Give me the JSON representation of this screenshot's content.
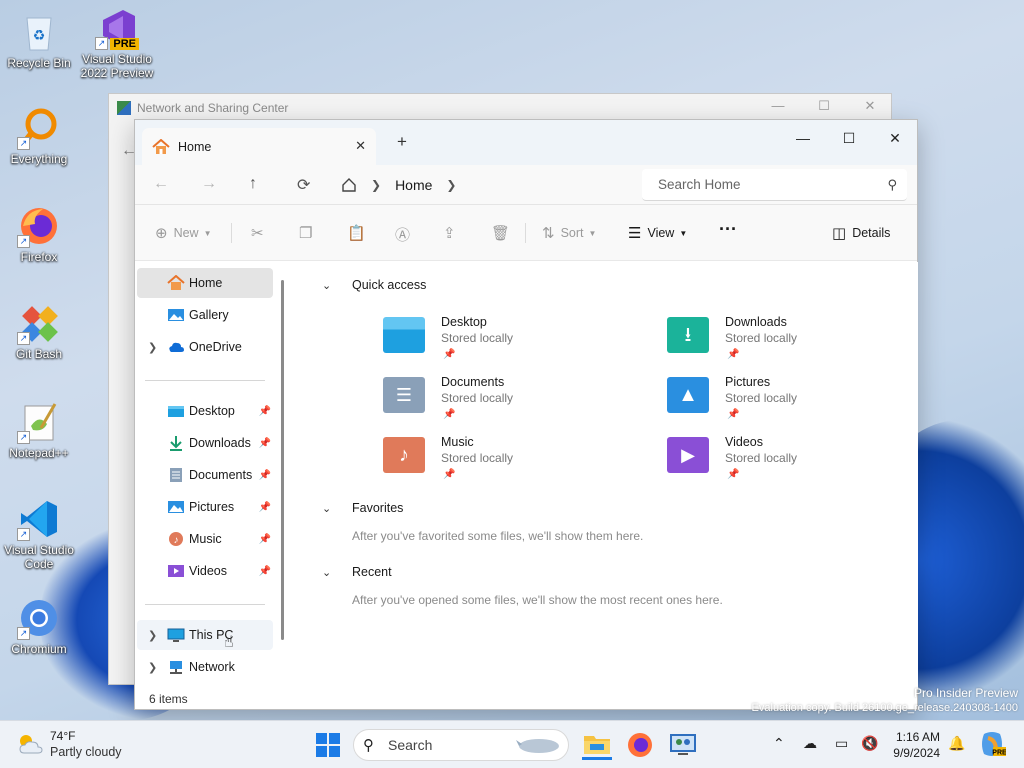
{
  "desktop": {
    "icons": [
      {
        "label": "Recycle Bin",
        "icon": "recycle-bin-icon"
      },
      {
        "label": "Visual Studio 2022 Preview",
        "icon": "visual-studio-preview-icon",
        "badge": "PRE"
      },
      {
        "label": "Everything",
        "icon": "everything-search-icon"
      },
      {
        "label": "Firefox",
        "icon": "firefox-icon"
      },
      {
        "label": "Git Bash",
        "icon": "git-bash-icon"
      },
      {
        "label": "Notepad++",
        "icon": "notepad-plus-plus-icon"
      },
      {
        "label": "Visual Studio Code",
        "icon": "vscode-icon"
      },
      {
        "label": "Chromium",
        "icon": "chromium-icon"
      }
    ],
    "watermark_line1": "Pro Insider Preview",
    "watermark_line2": "Evaluation copy. Build 26100.ge_release.240308-1400"
  },
  "background_window": {
    "title": "Network and Sharing Center"
  },
  "explorer": {
    "tab_label": "Home",
    "breadcrumb": "Home",
    "search_placeholder": "Search Home",
    "commands": {
      "new": "New",
      "sort": "Sort",
      "view": "View",
      "more": "···",
      "details": "Details"
    },
    "sidebar": {
      "top": [
        {
          "label": "Home",
          "icon": "home-icon",
          "selected": true
        },
        {
          "label": "Gallery",
          "icon": "gallery-icon"
        },
        {
          "label": "OneDrive",
          "icon": "onedrive-icon",
          "expandable": true
        }
      ],
      "pinned": [
        {
          "label": "Desktop",
          "icon": "desktop-folder-icon"
        },
        {
          "label": "Downloads",
          "icon": "downloads-icon"
        },
        {
          "label": "Documents",
          "icon": "documents-icon"
        },
        {
          "label": "Pictures",
          "icon": "pictures-icon"
        },
        {
          "label": "Music",
          "icon": "music-icon"
        },
        {
          "label": "Videos",
          "icon": "videos-icon"
        }
      ],
      "bottom": [
        {
          "label": "This PC",
          "icon": "this-pc-icon"
        },
        {
          "label": "Network",
          "icon": "network-icon"
        }
      ]
    },
    "status": "6 items",
    "sections": {
      "quick_access": "Quick access",
      "favorites": "Favorites",
      "favorites_empty": "After you've favorited some files, we'll show them here.",
      "recent": "Recent",
      "recent_empty": "After you've opened some files, we'll show the most recent ones here."
    },
    "quick_access_items": [
      {
        "name": "Desktop",
        "sub": "Stored locally",
        "color": "#1ea0e0"
      },
      {
        "name": "Downloads",
        "sub": "Stored locally",
        "color": "#1bb39a"
      },
      {
        "name": "Documents",
        "sub": "Stored locally",
        "color": "#8aa0b8"
      },
      {
        "name": "Pictures",
        "sub": "Stored locally",
        "color": "#2a8fe0"
      },
      {
        "name": "Music",
        "sub": "Stored locally",
        "color": "#e07a5a"
      },
      {
        "name": "Videos",
        "sub": "Stored locally",
        "color": "#8a4fd6"
      }
    ]
  },
  "taskbar": {
    "temperature": "74°F",
    "condition": "Partly cloudy",
    "search_label": "Search",
    "time": "1:16 AM",
    "date": "9/9/2024"
  }
}
